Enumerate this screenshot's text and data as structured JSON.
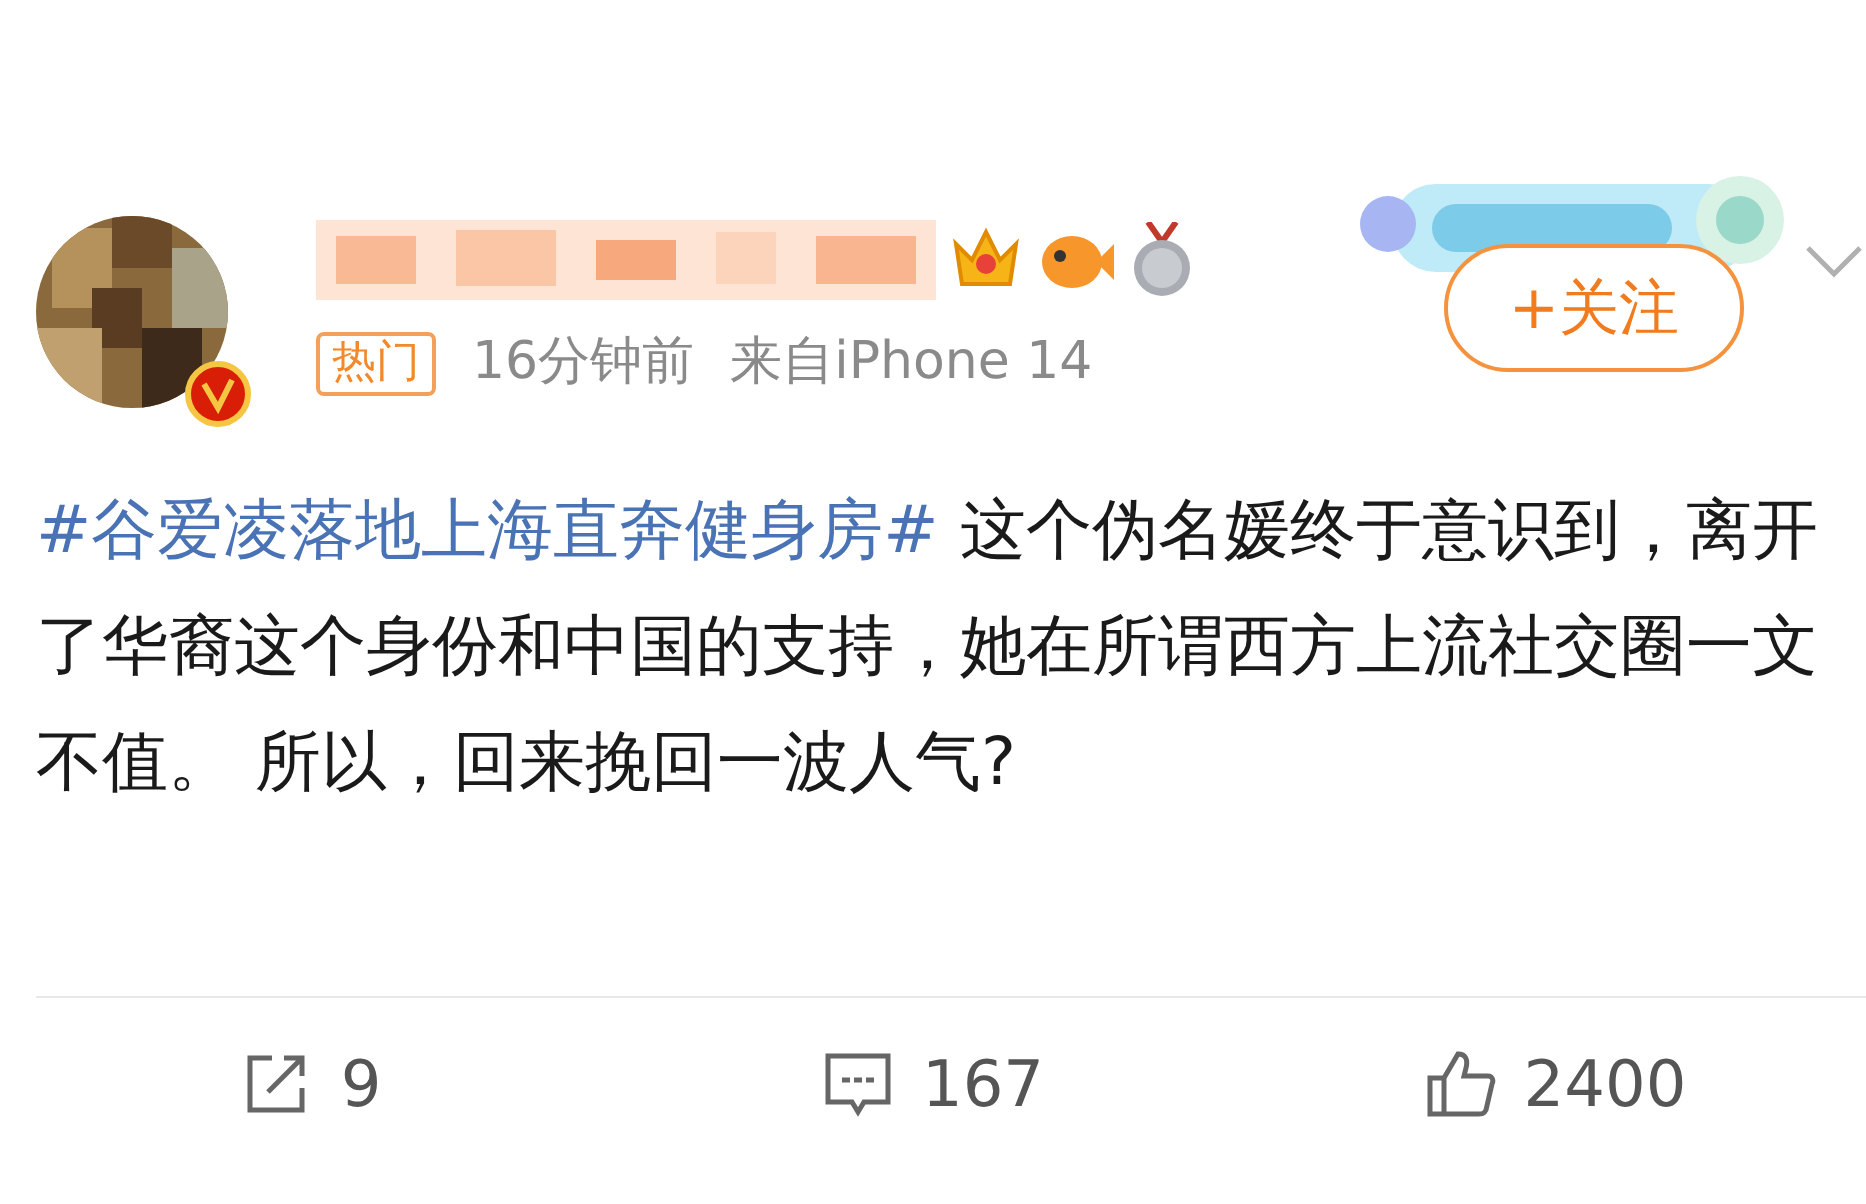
{
  "post": {
    "hot_tag": "热门",
    "time": "16分钟前",
    "source": "来自iPhone 14",
    "follow_button": "+关注",
    "topic": "#谷爱凌落地上海直奔健身房#",
    "text": " 这个伪名媛终于意识到，离开了华裔这个身份和中国的支持，她在所谓西方上流社交圈一文不值。 所以，回来挽回一波人气?"
  },
  "actions": [
    {
      "kind": "repost",
      "count": "9"
    },
    {
      "kind": "comment",
      "count": "167"
    },
    {
      "kind": "like",
      "count": "2400"
    }
  ]
}
